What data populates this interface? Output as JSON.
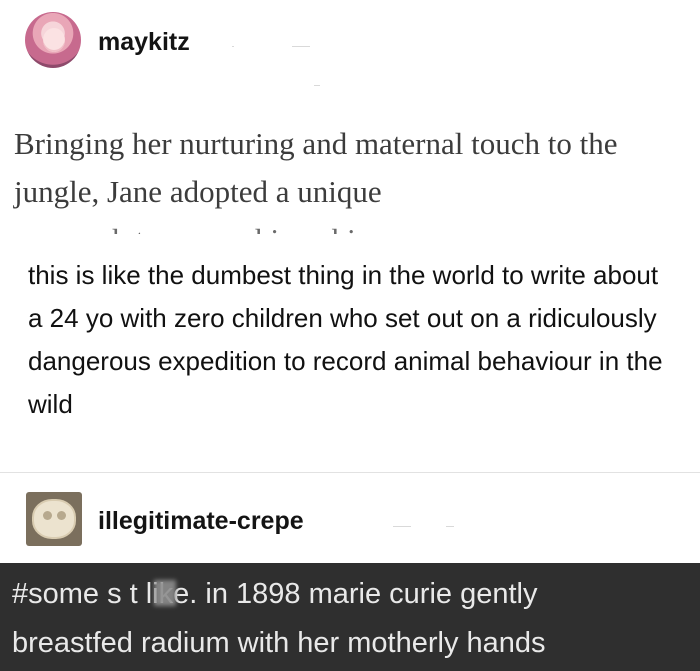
{
  "post": {
    "author": "maykitz",
    "quoted_text": "Bringing her nurturing and maternal touch to the jungle, Jane adopted a unique",
    "quoted_cutoff_text": "approach to researching chimpanzees",
    "comment": "this is like the dumbest thing in the world to write about a 24 yo with zero children who set out on a ridiculously dangerous expedition to record animal behaviour in the wild"
  },
  "reblog": {
    "author": "illegitimate-crepe",
    "tag_line_1": "#some s  t like. in 1898 marie curie gently",
    "tag_line_2": "breastfed radium with her motherly hands"
  }
}
